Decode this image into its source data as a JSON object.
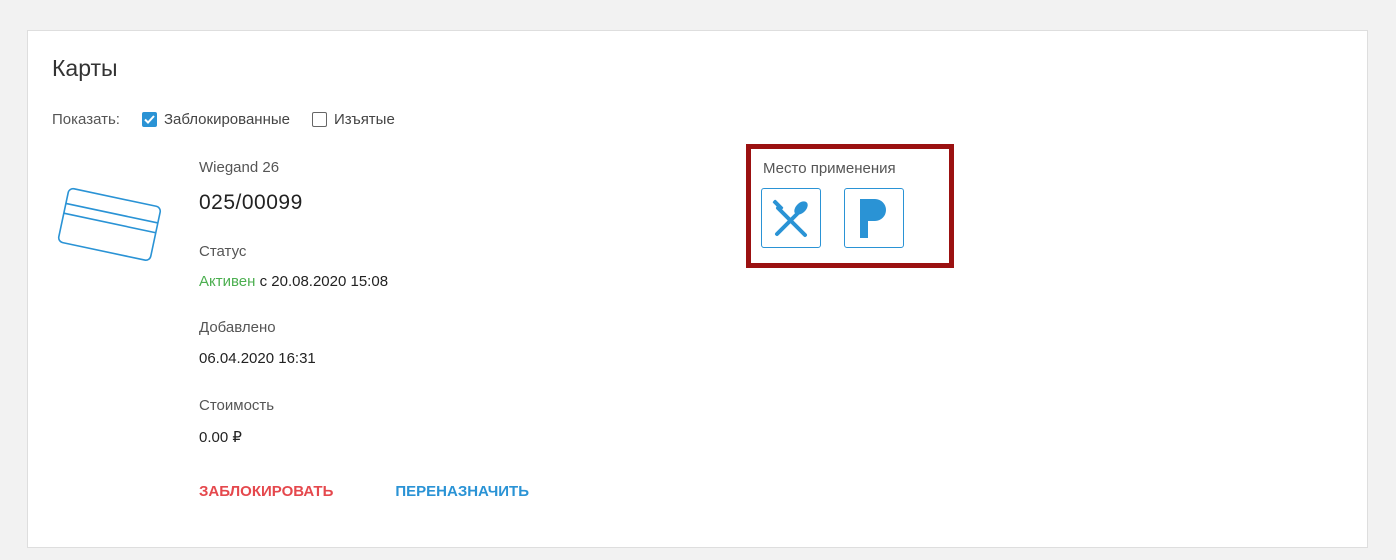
{
  "page": {
    "title": "Карты"
  },
  "filters": {
    "show_label": "Показать:",
    "options": [
      {
        "label": "Заблокированные",
        "checked": true
      },
      {
        "label": "Изъятые",
        "checked": false
      }
    ]
  },
  "card": {
    "type": "Wiegand 26",
    "number": "025/00099",
    "status_label": "Статус",
    "status_value": "Активен",
    "status_since": " с 20.08.2020 15:08",
    "added_label": "Добавлено",
    "added_value": "06.04.2020 16:31",
    "cost_label": "Стоимость",
    "cost_value": "0.00 ₽"
  },
  "actions": {
    "block_label": "ЗАБЛОКИРОВАТЬ",
    "reassign_label": "ПЕРЕНАЗНАЧИТЬ"
  },
  "usage": {
    "label": "Место применения",
    "icons": [
      "fork-spoon-icon",
      "parking-icon"
    ]
  },
  "colors": {
    "accent": "#2a93d5",
    "danger": "#e5484d",
    "active": "#4caf50",
    "highlight_border": "#9b1111"
  }
}
